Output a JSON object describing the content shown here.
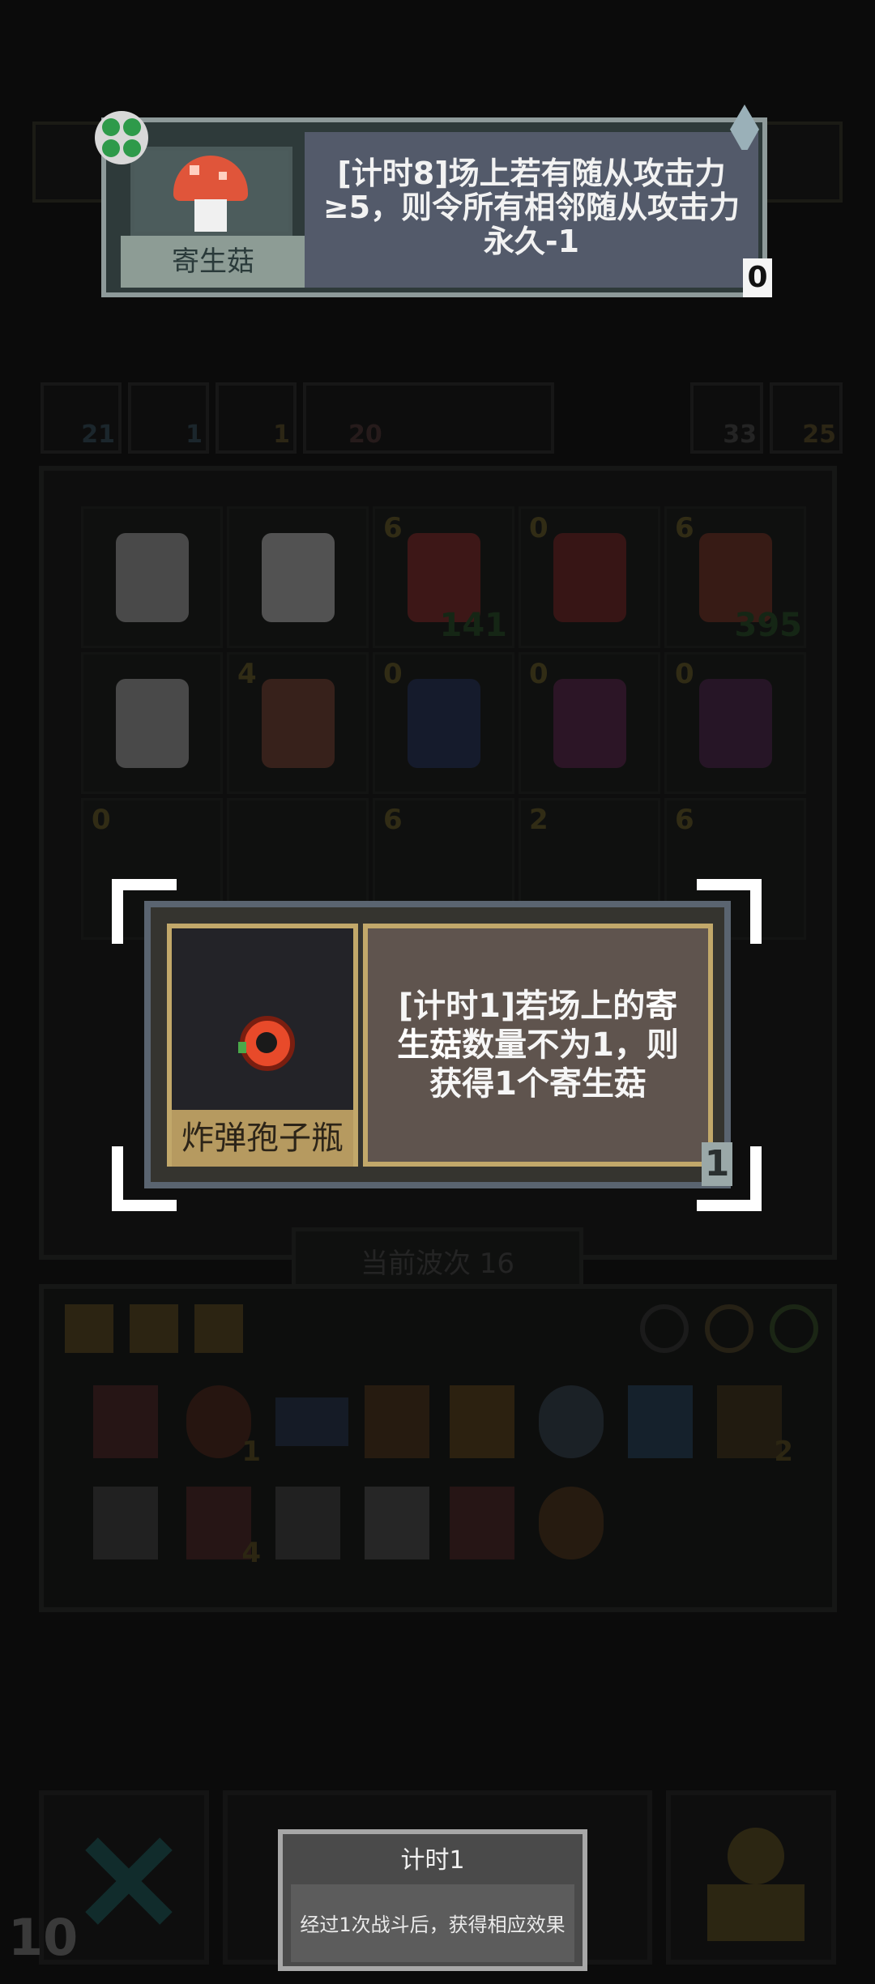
{
  "tooltip_top": {
    "name": "寄生菇",
    "description": "[计时8]场上若有随从攻击力≥5，则令所有相邻随从攻击力永久-1",
    "counter": "0",
    "left_icon": "clover-icon",
    "right_icon": "spear-icon"
  },
  "stats": {
    "left": [
      "21",
      "1",
      "1",
      "20"
    ],
    "right": [
      "33",
      "25"
    ]
  },
  "board": {
    "row1": [
      {
        "level": "",
        "value": ""
      },
      {
        "level": "",
        "value": ""
      },
      {
        "level": "6",
        "value": "141"
      },
      {
        "level": "0",
        "value": ""
      },
      {
        "level": "6",
        "value": "395"
      }
    ],
    "row2": [
      {
        "level": "",
        "value": ""
      },
      {
        "level": "4",
        "value": ""
      },
      {
        "level": "0",
        "value": ""
      },
      {
        "level": "0",
        "value": ""
      },
      {
        "level": "0",
        "value": ""
      }
    ],
    "row3": [
      {
        "level": "0",
        "value": ""
      },
      {
        "level": "",
        "value": ""
      },
      {
        "level": "6",
        "value": ""
      },
      {
        "level": "2",
        "value": ""
      },
      {
        "level": "6",
        "value": ""
      }
    ]
  },
  "wave_label": "当前波次 16",
  "item_card": {
    "name": "炸弹孢子瓶",
    "description_parts": [
      "[计时1]若场上的",
      "寄生菇",
      "数量不为1，则获得1个寄生菇"
    ],
    "counter": "1",
    "icon": "bomb-flask-icon"
  },
  "inventory": {
    "counts": [
      "1",
      "2",
      "4"
    ]
  },
  "bottom_popup": {
    "title": "计时1",
    "body": "经过1次战斗后，获得相应效果"
  },
  "corner_number": "10",
  "colors": {
    "card_gold": "#c2a86a",
    "tooltip_desc_bg": "#535a6a",
    "highlight_green": "#2a5a2a"
  }
}
